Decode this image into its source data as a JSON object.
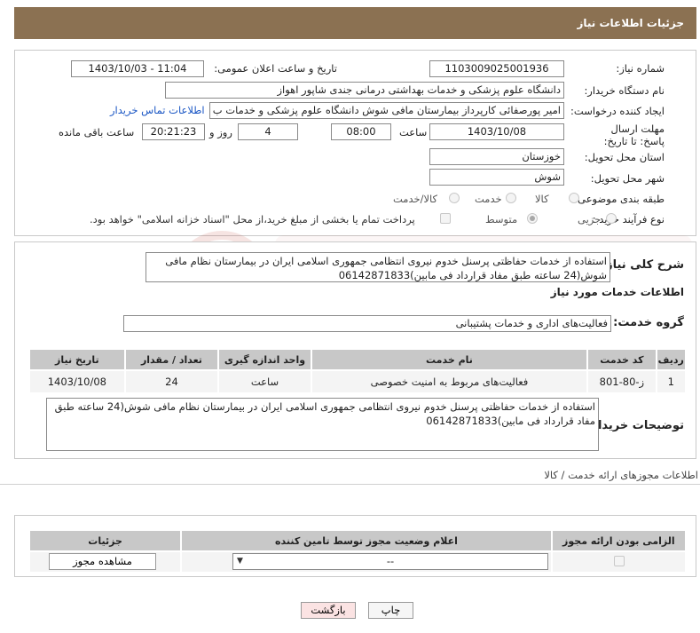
{
  "header": {
    "title": "جزئیات اطلاعات نیاز"
  },
  "form": {
    "need_number_label": "شماره نیاز:",
    "need_number": "1103009025001936",
    "announce_label": "تاریخ و ساعت اعلان عمومی:",
    "announce_value": "1403/10/03 - 11:04",
    "buyer_org_label": "نام دستگاه خریدار:",
    "buyer_org": "دانشگاه علوم پزشکی و خدمات بهداشتی درمانی جندی شاپور اهواز",
    "creator_label": "ایجاد کننده درخواست:",
    "creator": "امیر پورصفائی کارپرداز بیمارستان مافی شوش دانشگاه علوم پزشکی و خدمات ب",
    "contact_link": "اطلاعات تماس خریدار",
    "deadline_label": "مهلت ارسال پاسخ: تا تاریخ:",
    "deadline_date": "1403/10/08",
    "time_label": "ساعت",
    "deadline_time": "08:00",
    "days_value": "4",
    "days_label": "روز و",
    "remaining_time": "20:21:23",
    "remaining_label": "ساعت باقی مانده",
    "province_label": "استان محل تحویل:",
    "province": "خوزستان",
    "city_label": "شهر محل تحویل:",
    "city": "شوش",
    "category_label": "طبقه بندی موضوعی:",
    "category_options": [
      "کالا",
      "خدمت",
      "کالا/خدمت"
    ],
    "purchase_type_label": "نوع فرآیند خرید :",
    "purchase_options": [
      "جزیی",
      "متوسط"
    ],
    "payment_note": "پرداخت تمام یا بخشی از مبلغ خرید،از محل \"اسناد خزانه اسلامی\" خواهد بود."
  },
  "summary": {
    "label": "شرح کلی نیاز:",
    "text": "استفاده از خدمات حفاظتی پرسنل خدوم نیروی انتظامی جمهوری اسلامی ایران در بیمارستان نظام مافی شوش(24 ساعته طبق مفاد قرارداد فی مابین)06142871833"
  },
  "services": {
    "section_title": "اطلاعات خدمات مورد نیاز",
    "group_label": "گروه خدمت:",
    "group_value": "فعالیت‌های اداری و خدمات پشتیبانی",
    "columns": [
      "ردیف",
      "کد خدمت",
      "نام خدمت",
      "واحد اندازه گیری",
      "تعداد / مقدار",
      "تاریخ نیاز"
    ],
    "rows": [
      {
        "row": "1",
        "code": "ز-80-801",
        "name": "فعالیت‌های مربوط به امنیت خصوصی",
        "unit": "ساعت",
        "qty": "24",
        "date": "1403/10/08"
      }
    ]
  },
  "buyer_notes": {
    "label": "توضیحات خریدار:",
    "text": "استفاده از خدمات حفاظتی پرسنل خدوم نیروی انتظامی جمهوری اسلامی ایران در بیمارستان نظام مافی شوش(24 ساعته طبق مفاد قرارداد فی مابین)06142871833"
  },
  "permits": {
    "section_title": "اطلاعات مجوزهای ارائه خدمت / کالا",
    "columns": [
      "الزامی بودن ارائه مجوز",
      "اعلام وضعیت مجوز توسط تامین کننده",
      "جزئیات"
    ],
    "select_value": "--",
    "view_button": "مشاهده مجوز"
  },
  "footer": {
    "print_button": "چاپ",
    "back_button": "بازگشت"
  },
  "colors": {
    "header_bg": "#8b7152",
    "link": "#1a56c4",
    "back_button_bg": "#fbe3e3"
  }
}
